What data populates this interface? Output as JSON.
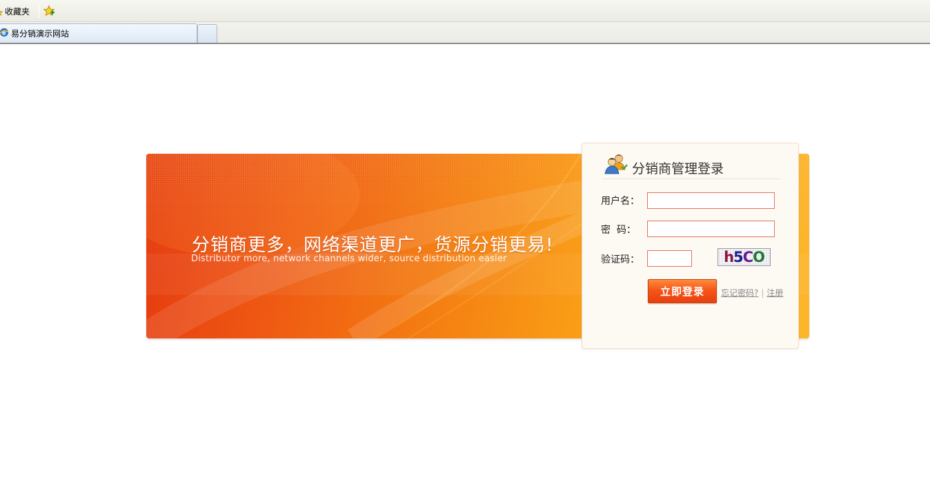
{
  "browser": {
    "favorites_label": "收藏夹",
    "tab_title": "易分销演示网站"
  },
  "banner": {
    "headline": "分销商更多，网络渠道更广，货源分销更易!",
    "subline": "Distributor more, network channels wider, source distribution easier"
  },
  "login": {
    "title": "分销商管理登录",
    "username_label": "用户名：",
    "username_value": "",
    "password_label": "密  码：",
    "password_value": "",
    "captcha_label": "验证码：",
    "captcha_value": "",
    "captcha_chars": [
      "h",
      "5",
      "C",
      "O"
    ],
    "submit_label": "立即登录",
    "forgot_label": "忘记密码?",
    "separator": "|",
    "register_label": "注册"
  },
  "colors": {
    "accent": "#f4561a",
    "banner_start": "#e5390f",
    "banner_end": "#fdb62a",
    "field_border": "#e9705a"
  }
}
